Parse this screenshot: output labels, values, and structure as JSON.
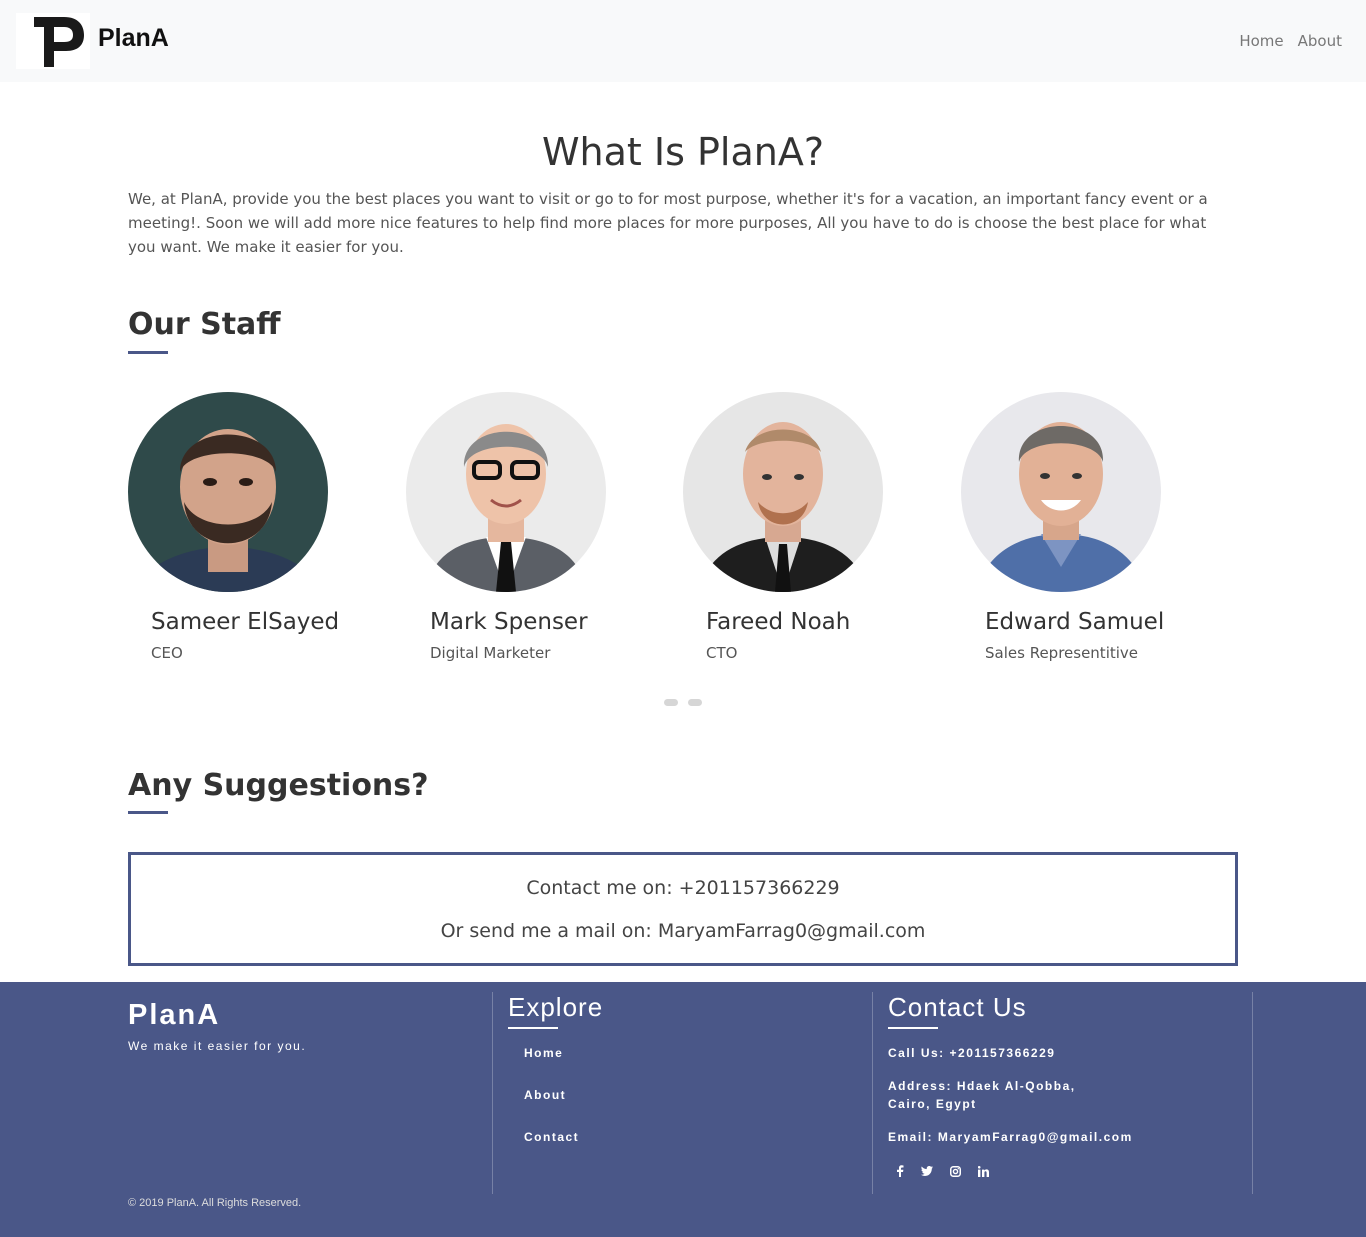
{
  "navbar": {
    "brand": "PlanA",
    "links": [
      {
        "label": "Home"
      },
      {
        "label": "About"
      }
    ]
  },
  "about": {
    "title": "What Is PlanA?",
    "text": "We, at PlanA, provide you the best places you want to visit or go to for most purpose, whether it's for a vacation, an important fancy event or a meeting!. Soon we will add more nice features to help find more places for more purposes, All you have to do is choose the best place for what you want. We make it easier for you."
  },
  "staff": {
    "title": "Our Staff",
    "members": [
      {
        "name": "Sameer ElSayed",
        "role": "CEO"
      },
      {
        "name": "Mark Spenser",
        "role": "Digital Marketer"
      },
      {
        "name": "Fareed Noah",
        "role": "CTO"
      },
      {
        "name": "Edward Samuel",
        "role": "Sales Representitive"
      }
    ],
    "carousel_pages": 2
  },
  "suggestions": {
    "title": "Any Suggestions?",
    "phone_line": "Contact me on: +201157366229",
    "mail_line": "Or send me a mail on: MaryamFarrag0@gmail.com"
  },
  "footer": {
    "brand": "PlanA",
    "tagline": "We make it easier for you.",
    "explore": {
      "title": "Explore",
      "links": [
        "Home",
        "About",
        "Contact"
      ]
    },
    "contact": {
      "title": "Contact Us",
      "call": "Call Us: +201157366229",
      "address_1": "Address: Hdaek Al-Qobba,",
      "address_2": "Cairo, Egypt",
      "email": "Email: MaryamFarrag0@gmail.com",
      "social_icons": [
        "facebook-icon",
        "twitter-icon",
        "instagram-icon",
        "linkedin-icon"
      ]
    },
    "copyright": "© 2019 PlanA. All Rights Reserved.",
    "background_color": "#4a5788"
  }
}
